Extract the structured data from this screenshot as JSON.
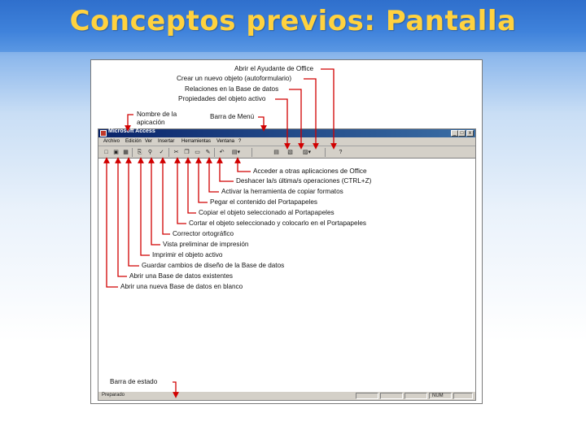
{
  "slide": {
    "title": "Conceptos previos: Pantalla"
  },
  "window": {
    "title": "Microsoft Access",
    "controls": [
      "_",
      "□",
      "x"
    ],
    "menu": [
      "Archivo",
      "Edición",
      "Ver",
      "Insertar",
      "Herramientas",
      "Ventana",
      "?"
    ],
    "status_text": "Preparado",
    "status_num": "NUM"
  },
  "labels": {
    "ayudante": "Abrir el Ayudante de Office",
    "autoformulario": "Crear un nuevo objeto (autoformulario)",
    "relaciones": "Relaciones en la Base de datos",
    "propiedades": "Propiedades del objeto activo",
    "nombre_app_1": "Nombre de la",
    "nombre_app_2": "apicación",
    "barra_menu": "Barra de Menú",
    "acceder": "Acceder a otras aplicaciones de Office",
    "deshacer": "Deshacer la/s última/s operaciones (CTRL+Z)",
    "copiar_formatos": "Activar la herramienta de copiar formatos",
    "pegar": "Pegar el contenido del Portapapeles",
    "copiar": "Copiar el objeto seleccionado al Portapapeles",
    "cortar": "Cortar el objeto seleccionado y colocarlo en el Portapapeles",
    "corrector": "Corrector ortográfico",
    "vista_previa": "Vista preliminar de impresión",
    "imprimir": "Imprimir el objeto activo",
    "guardar": "Guardar cambios de diseño de la Base de datos",
    "abrir": "Abrir una Base de datos existentes",
    "nueva": "Abrir una nueva Base de datos en blanco",
    "barra_estado": "Barra de estado"
  },
  "icons": [
    "new-icon",
    "open-icon",
    "save-icon",
    "print-icon",
    "preview-icon",
    "spell-icon",
    "cut-icon",
    "copy-icon",
    "paste-icon",
    "format-painter-icon",
    "undo-icon",
    "office-links-icon",
    "properties-icon",
    "relationships-icon",
    "new-object-icon",
    "help-icon"
  ],
  "colors": {
    "title": "#ffd23f",
    "titlebar": "#0a246a",
    "arrow": "#d10000"
  }
}
